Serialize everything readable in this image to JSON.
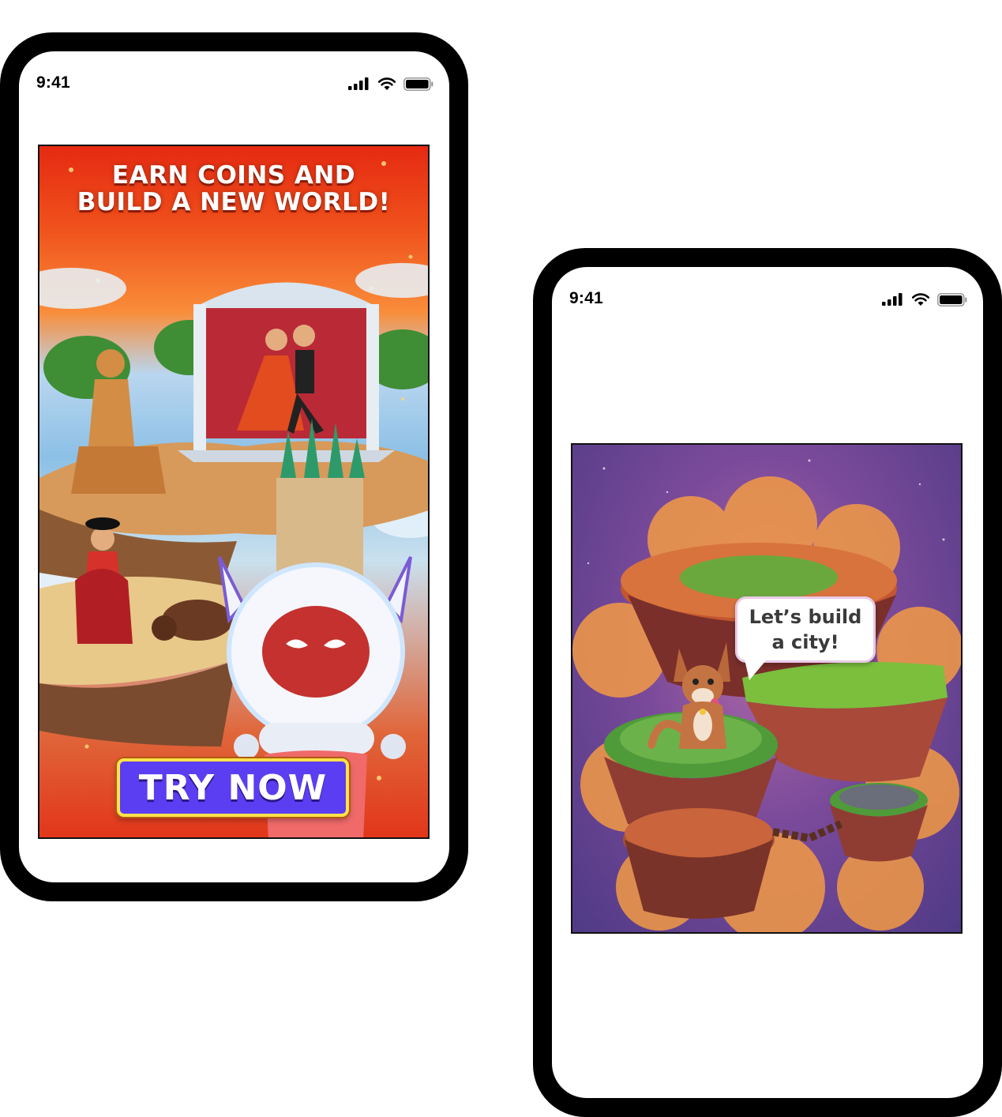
{
  "phones": {
    "left": {
      "status_bar": {
        "time": "9:41",
        "icons": [
          "signal-icon",
          "wifi-icon",
          "battery-icon"
        ]
      },
      "ad": {
        "headline_line1": "EARN COINS AND",
        "headline_line2": "BUILD A NEW WORLD!",
        "cta_label": "TRY NOW"
      }
    },
    "right": {
      "status_bar": {
        "time": "9:41",
        "icons": [
          "signal-icon",
          "wifi-icon",
          "battery-icon"
        ]
      },
      "scene": {
        "speech_line1": "Let’s build",
        "speech_line2": "a city!"
      }
    }
  },
  "colors": {
    "device_frame": "#000000",
    "cta_background": "#5b3df2",
    "cta_border": "#ffe24a",
    "ad_top": "#e52a12",
    "scene_background": "#7a4a9a"
  }
}
